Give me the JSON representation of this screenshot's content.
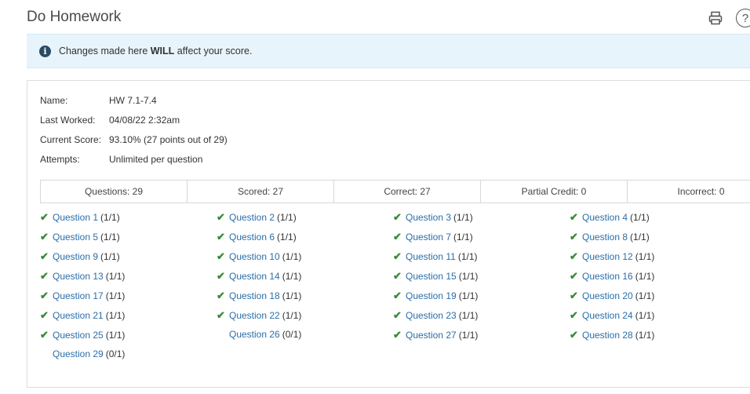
{
  "header": {
    "title": "Do Homework"
  },
  "icons": {
    "print": "print-icon",
    "help": "help-icon",
    "info": "info-icon"
  },
  "banner": {
    "prefix": "Changes made here ",
    "bold": "WILL",
    "suffix": " affect your score."
  },
  "details": [
    {
      "label": "Name:",
      "value": "HW 7.1-7.4"
    },
    {
      "label": "Last Worked:",
      "value": "04/08/22 2:32am"
    },
    {
      "label": "Current Score:",
      "value": "93.10% (27 points out of 29)"
    },
    {
      "label": "Attempts:",
      "value": "Unlimited per question"
    }
  ],
  "stats": [
    "Questions: 29",
    "Scored: 27",
    "Correct: 27",
    "Partial Credit: 0",
    "Incorrect: 0"
  ],
  "colors": {
    "link": "#2a6ea8",
    "check": "#3a8a3a",
    "banner_bg": "#e7f4fb"
  },
  "questions": [
    {
      "label": "Question 1",
      "score": "(1/1)",
      "correct": true
    },
    {
      "label": "Question 2",
      "score": "(1/1)",
      "correct": true
    },
    {
      "label": "Question 3",
      "score": "(1/1)",
      "correct": true
    },
    {
      "label": "Question 4",
      "score": "(1/1)",
      "correct": true
    },
    {
      "label": "Question 5",
      "score": "(1/1)",
      "correct": true
    },
    {
      "label": "Question 6",
      "score": "(1/1)",
      "correct": true
    },
    {
      "label": "Question 7",
      "score": "(1/1)",
      "correct": true
    },
    {
      "label": "Question 8",
      "score": "(1/1)",
      "correct": true
    },
    {
      "label": "Question 9",
      "score": "(1/1)",
      "correct": true
    },
    {
      "label": "Question 10",
      "score": "(1/1)",
      "correct": true
    },
    {
      "label": "Question 11",
      "score": "(1/1)",
      "correct": true
    },
    {
      "label": "Question 12",
      "score": "(1/1)",
      "correct": true
    },
    {
      "label": "Question 13",
      "score": "(1/1)",
      "correct": true
    },
    {
      "label": "Question 14",
      "score": "(1/1)",
      "correct": true
    },
    {
      "label": "Question 15",
      "score": "(1/1)",
      "correct": true
    },
    {
      "label": "Question 16",
      "score": "(1/1)",
      "correct": true
    },
    {
      "label": "Question 17",
      "score": "(1/1)",
      "correct": true
    },
    {
      "label": "Question 18",
      "score": "(1/1)",
      "correct": true
    },
    {
      "label": "Question 19",
      "score": "(1/1)",
      "correct": true
    },
    {
      "label": "Question 20",
      "score": "(1/1)",
      "correct": true
    },
    {
      "label": "Question 21",
      "score": "(1/1)",
      "correct": true
    },
    {
      "label": "Question 22",
      "score": "(1/1)",
      "correct": true
    },
    {
      "label": "Question 23",
      "score": "(1/1)",
      "correct": true
    },
    {
      "label": "Question 24",
      "score": "(1/1)",
      "correct": true
    },
    {
      "label": "Question 25",
      "score": "(1/1)",
      "correct": true
    },
    {
      "label": "Question 26",
      "score": "(0/1)",
      "correct": false
    },
    {
      "label": "Question 27",
      "score": "(1/1)",
      "correct": true
    },
    {
      "label": "Question 28",
      "score": "(1/1)",
      "correct": true
    },
    {
      "label": "Question 29",
      "score": "(0/1)",
      "correct": false
    }
  ]
}
